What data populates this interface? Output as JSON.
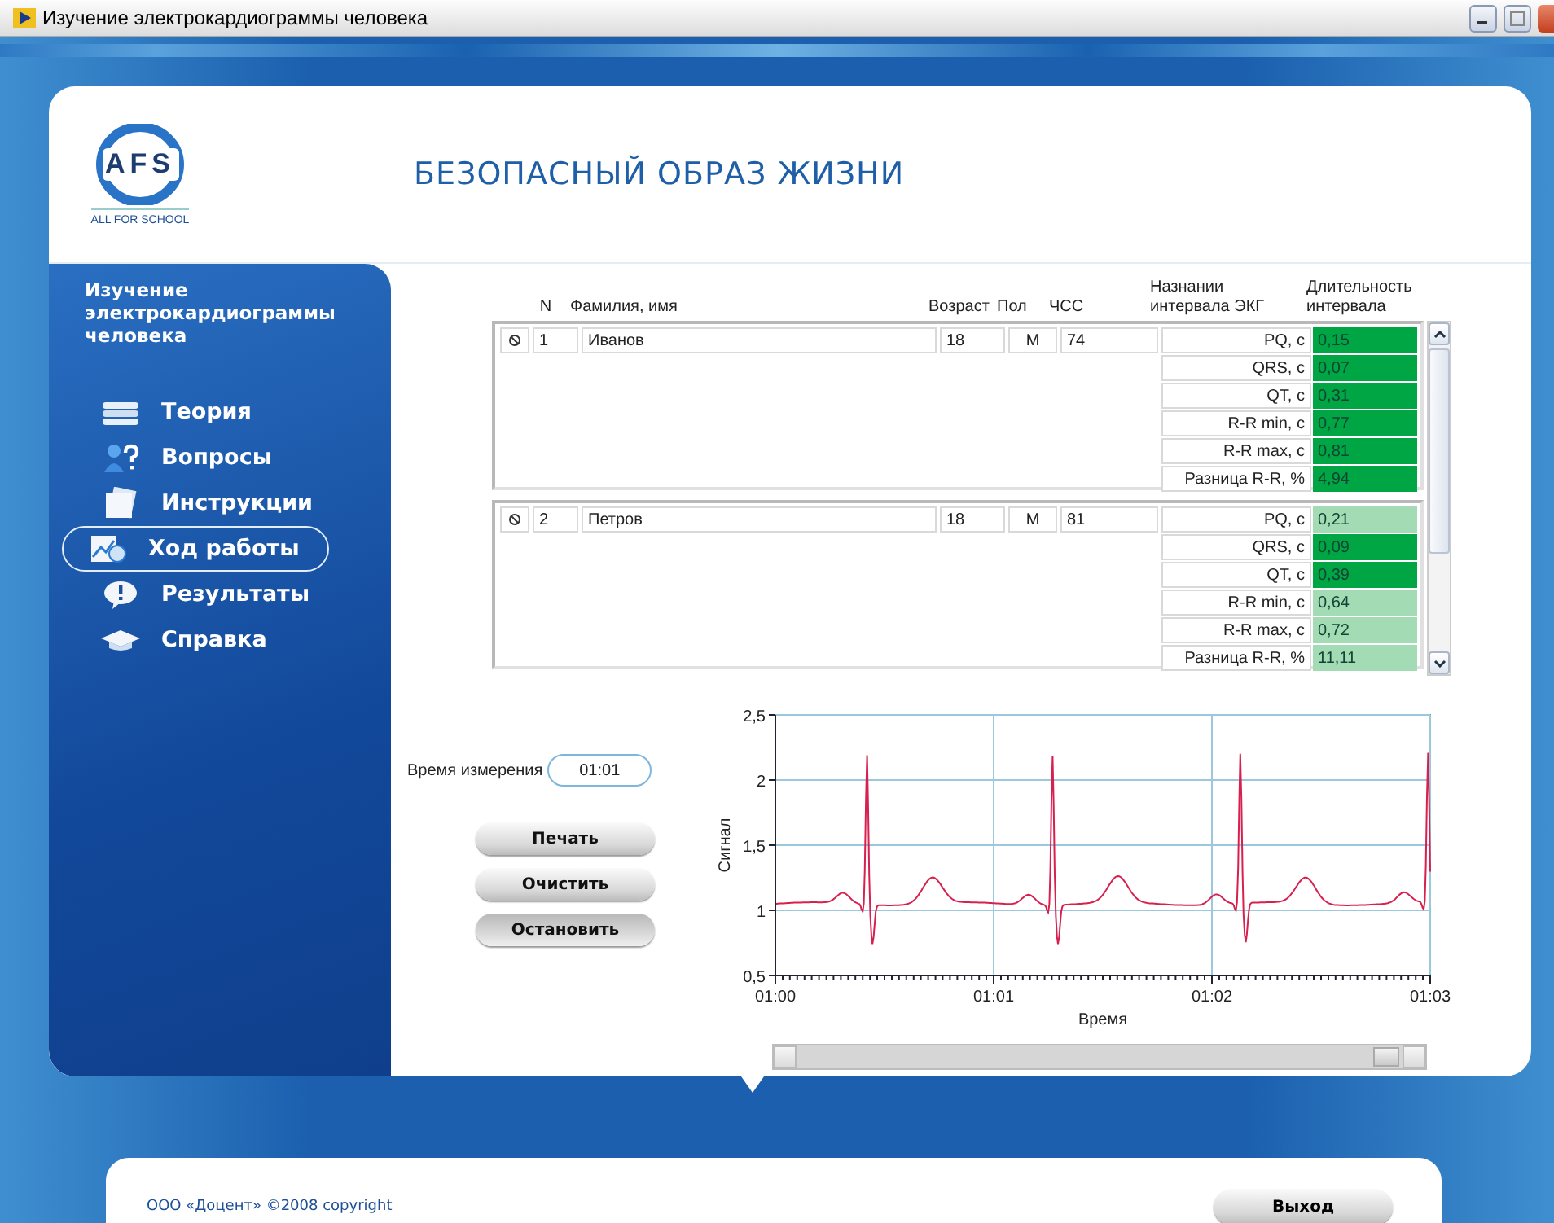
{
  "window": {
    "title": "Изучение электрокардиограммы человека"
  },
  "header": {
    "logo_text": "AFS",
    "logo_caption": "ALL FOR SCHOOL",
    "title": "БЕЗОПАСНЫЙ ОБРАЗ ЖИЗНИ"
  },
  "sidebar": {
    "title": "Изучение электрокардиограммы человека",
    "items": [
      {
        "label": "Теория",
        "selected": false
      },
      {
        "label": "Вопросы",
        "selected": false
      },
      {
        "label": "Инструкции",
        "selected": false
      },
      {
        "label": "Ход работы",
        "selected": true
      },
      {
        "label": "Результаты",
        "selected": false
      },
      {
        "label": "Справка",
        "selected": false
      }
    ]
  },
  "table": {
    "columns": [
      "N",
      "Фамилия, имя",
      "Возраст",
      "Пол",
      "ЧСС",
      "Назнании интервала ЭКГ",
      "Длительность интервала"
    ],
    "records": [
      {
        "n": "1",
        "name": "Иванов",
        "age": "18",
        "sex": "М",
        "hr": "74",
        "intervals": [
          {
            "name": "PQ, с",
            "value": "0,15",
            "color": "#00a544"
          },
          {
            "name": "QRS, с",
            "value": "0,07",
            "color": "#00a544"
          },
          {
            "name": "QT, с",
            "value": "0,31",
            "color": "#00a544"
          },
          {
            "name": "R-R min, с",
            "value": "0,77",
            "color": "#00a544"
          },
          {
            "name": "R-R max, с",
            "value": "0,81",
            "color": "#00a544"
          },
          {
            "name": "Разница R-R, %",
            "value": "4,94",
            "color": "#00a544"
          }
        ]
      },
      {
        "n": "2",
        "name": "Петров",
        "age": "18",
        "sex": "М",
        "hr": "81",
        "intervals": [
          {
            "name": "PQ, с",
            "value": "0,21",
            "color": "#a3dbb4"
          },
          {
            "name": "QRS, с",
            "value": "0,09",
            "color": "#00a544"
          },
          {
            "name": "QT, с",
            "value": "0,39",
            "color": "#00a544"
          },
          {
            "name": "R-R min, с",
            "value": "0,64",
            "color": "#a3dbb4"
          },
          {
            "name": "R-R max, с",
            "value": "0,72",
            "color": "#a3dbb4"
          },
          {
            "name": "Разница R-R, %",
            "value": "11,11",
            "color": "#a3dbb4"
          }
        ]
      }
    ]
  },
  "measurement": {
    "label": "Время измерения",
    "value": "01:01"
  },
  "buttons": [
    {
      "label": "Печать",
      "pressed": false
    },
    {
      "label": "Очистить",
      "pressed": false
    },
    {
      "label": "Остановить",
      "pressed": true
    }
  ],
  "plot": {
    "ylabel": "Сигнал",
    "xlabel": "Время",
    "yticks": [
      "2,5",
      "2",
      "1,5",
      "1",
      "0,5"
    ],
    "xticks": [
      "01:00",
      "01:01",
      "01:02",
      "01:03"
    ]
  },
  "footer": {
    "copyright": "ООО «Доцент» ©2008 copyright",
    "exit": "Выход"
  }
}
